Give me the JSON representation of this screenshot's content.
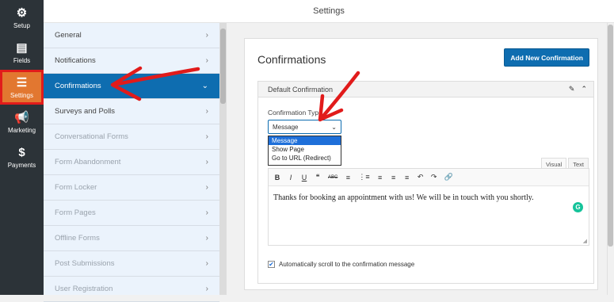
{
  "topbar": {
    "title": "Settings"
  },
  "leftnav": [
    {
      "label": "Setup",
      "icon": "gear-icon",
      "glyph": "⚙"
    },
    {
      "label": "Fields",
      "icon": "fields-icon",
      "glyph": "▤"
    },
    {
      "label": "Settings",
      "icon": "sliders-icon",
      "glyph": "☰"
    },
    {
      "label": "Marketing",
      "icon": "megaphone-icon",
      "glyph": "📢"
    },
    {
      "label": "Payments",
      "icon": "dollar-icon",
      "glyph": "$"
    }
  ],
  "panel": [
    {
      "label": "General"
    },
    {
      "label": "Notifications"
    },
    {
      "label": "Confirmations"
    },
    {
      "label": "Surveys and Polls"
    },
    {
      "label": "Conversational Forms"
    },
    {
      "label": "Form Abandonment"
    },
    {
      "label": "Form Locker"
    },
    {
      "label": "Form Pages"
    },
    {
      "label": "Offline Forms"
    },
    {
      "label": "Post Submissions"
    },
    {
      "label": "User Registration"
    }
  ],
  "main": {
    "title": "Confirmations",
    "add_button": "Add New Confirmation",
    "box_title": "Default Confirmation",
    "field_label": "Confirmation Type",
    "select_value": "Message",
    "options": [
      "Message",
      "Show Page",
      "Go to URL (Redirect)"
    ],
    "tabs": [
      "Visual",
      "Text"
    ],
    "toolbar": [
      "B",
      "I",
      "U",
      "❝",
      "ABC",
      "≡",
      "⋮≡",
      "≡",
      "≡",
      "≡",
      "↶",
      "↷",
      "🔗"
    ],
    "message": "Thanks for booking an appointment with us! We will be in touch with you shortly.",
    "checkbox_label": "Automatically scroll to the confirmation message",
    "checkbox_checked": true
  },
  "colors": {
    "nav_bg": "#2c3338",
    "accent": "#e27730",
    "active_blue": "#0e6db0",
    "annotation_red": "#e11b1b"
  }
}
